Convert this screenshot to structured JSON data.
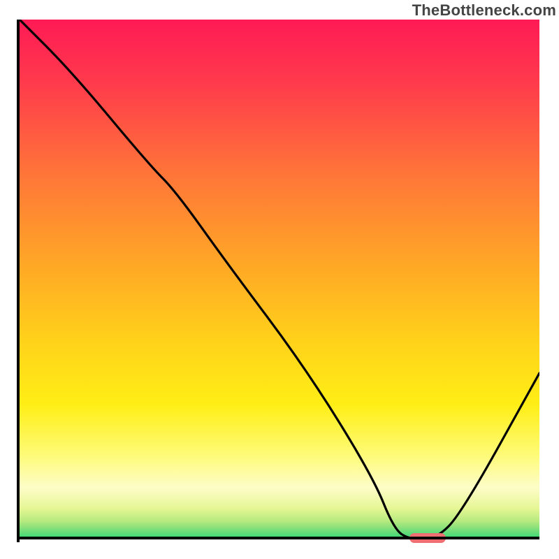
{
  "watermark": "TheBottleneck.com",
  "chart_data": {
    "type": "line",
    "title": "",
    "xlabel": "",
    "ylabel": "",
    "xlim": [
      0,
      100
    ],
    "ylim": [
      0,
      100
    ],
    "grid": false,
    "background_gradient": {
      "stops": [
        {
          "offset": 0,
          "color": "#ff1a55"
        },
        {
          "offset": 0.45,
          "color": "#ff9d2a"
        },
        {
          "offset": 0.68,
          "color": "#ffe715"
        },
        {
          "offset": 0.86,
          "color": "#fefca0"
        },
        {
          "offset": 0.955,
          "color": "#d8f07a"
        },
        {
          "offset": 1.0,
          "color": "#2fd675"
        }
      ]
    },
    "series": [
      {
        "name": "bottleneck-curve",
        "x": [
          0,
          10,
          25,
          30,
          40,
          55,
          68,
          72,
          75,
          80,
          85,
          100
        ],
        "y": [
          100,
          90,
          72,
          67,
          53,
          33,
          12,
          2,
          0,
          0,
          5,
          32
        ]
      }
    ],
    "optimal_marker": {
      "x_start": 75,
      "x_end": 82,
      "y": 0,
      "color": "#ef6e72"
    }
  }
}
